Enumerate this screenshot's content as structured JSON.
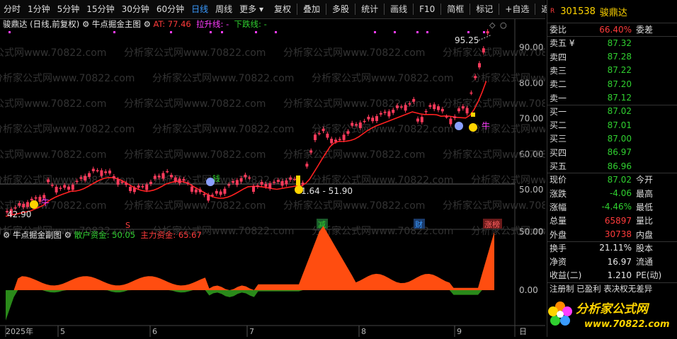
{
  "toolbar": {
    "periods": [
      "分时",
      "1分钟",
      "5分钟",
      "15分钟",
      "30分钟",
      "60分钟",
      "日线",
      "周线",
      "更多"
    ],
    "active": "日线",
    "actions": [
      "复权",
      "叠加",
      "多股",
      "统计",
      "画线",
      "F10",
      "简框",
      "标记",
      "+自选",
      "返回"
    ]
  },
  "main_header": {
    "stock_label": "骏鼎达 (日线,前复权)",
    "indicator": "牛点掘金主图",
    "at": "AT: 77.46",
    "up_line": "拉升线: -",
    "down_line": "下跌线: -"
  },
  "sub_header": {
    "indicator": "牛点掘金副图",
    "retail": "散户资金: 50.05",
    "main": "主力资金: 65.67"
  },
  "price_axis": [
    "90.00",
    "80.00",
    "70.00",
    "60.00",
    "50.00"
  ],
  "sub_axis": [
    "50.00",
    "0.00"
  ],
  "date_axis": [
    "2025年",
    "5",
    "6",
    "7",
    "8",
    "9",
    "日"
  ],
  "annotations": {
    "high": "95.25",
    "low": "42.90",
    "range": "1.64 - 51.90",
    "niu": "牛",
    "qian": "钱",
    "jian": "减",
    "cai": "财",
    "zhangbang": "涨榜",
    "s": "S"
  },
  "watermark": "分析家公式网www.70822.com",
  "quote": {
    "code": "301538",
    "name": "骏鼎达",
    "weibi_label": "委比",
    "weibi": "66.40%",
    "weicha_label": "委差",
    "asks": [
      {
        "label": "卖五",
        "flag": "¥",
        "price": "87.32"
      },
      {
        "label": "卖四",
        "flag": "",
        "price": "87.28"
      },
      {
        "label": "卖三",
        "flag": "",
        "price": "87.22"
      },
      {
        "label": "卖二",
        "flag": "",
        "price": "87.20"
      },
      {
        "label": "卖一",
        "flag": "",
        "price": "87.12"
      }
    ],
    "bids": [
      {
        "label": "买一",
        "price": "87.02"
      },
      {
        "label": "买二",
        "price": "87.01"
      },
      {
        "label": "买三",
        "price": "87.00"
      },
      {
        "label": "买四",
        "price": "86.97"
      },
      {
        "label": "买五",
        "price": "86.96"
      }
    ],
    "stats": [
      {
        "k": "现价",
        "v": "87.02",
        "k2": "今开",
        "color": "green"
      },
      {
        "k": "涨跌",
        "v": "-4.06",
        "k2": "最高",
        "color": "green"
      },
      {
        "k": "涨幅",
        "v": "-4.46%",
        "k2": "最低",
        "color": "green"
      },
      {
        "k": "总量",
        "v": "65897",
        "k2": "量比",
        "color": "red"
      },
      {
        "k": "外盘",
        "v": "30738",
        "k2": "内盘",
        "color": "red"
      }
    ],
    "stats2": [
      {
        "k": "换手",
        "v": "21.11%",
        "k2": "股本"
      },
      {
        "k": "净资",
        "v": "16.97",
        "k2": "流通"
      },
      {
        "k": "收益(二)",
        "v": "1.210",
        "k2": "PE(动)"
      }
    ],
    "footer_text": "注册制 已盈利 表决权无差异",
    "logo_text": "分析家公式网",
    "logo_url": "www.70822.com"
  }
}
